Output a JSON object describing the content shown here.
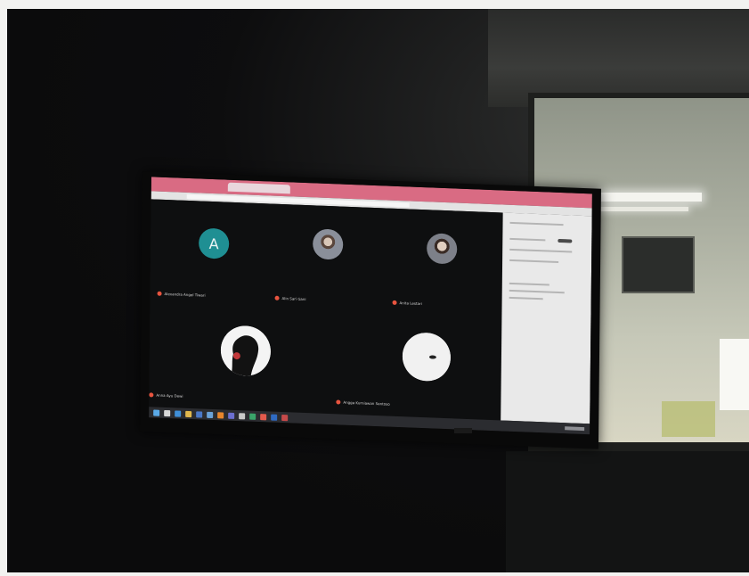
{
  "scene": {
    "description_free": true
  },
  "meeting": {
    "participants": [
      {
        "initial": "A",
        "name": "Alexandra Angel Tiwari",
        "avatar": "letter-avatar",
        "color": "#1f8f93"
      },
      {
        "name": "Alin Sari Gani",
        "avatar": "photo-avatar"
      },
      {
        "name": "Anita Lestari",
        "avatar": "photo-avatar"
      },
      {
        "name": "Anna Ayu Dewi",
        "avatar": "silhouette-avatar"
      },
      {
        "name": "Angga Kurniawan Santoso",
        "avatar": "blob-avatar"
      }
    ],
    "muted_icon": "mic-off-icon",
    "muted_color": "#e8543f"
  },
  "colors": {
    "browser_titlebar": "#d96b83",
    "meet_background": "#0e0f10",
    "side_panel": "#e9e9e9",
    "taskbar": "#2b2c30"
  },
  "taskbar": {
    "icons": [
      "start-icon",
      "search-icon",
      "edge-icon",
      "folder-icon",
      "store-icon",
      "mail-icon",
      "vlc-icon",
      "teams-icon",
      "app-icon",
      "app-icon",
      "chrome-icon",
      "word-icon",
      "app-icon"
    ],
    "icon_colors": [
      "#5aa9e6",
      "#d8d8d8",
      "#3f8fd8",
      "#e1b84d",
      "#4a78c6",
      "#6aa2d8",
      "#e8862c",
      "#6c6fd0",
      "#c9c9c9",
      "#3aa56a",
      "#e35a4c",
      "#2f6ac2",
      "#c64a4a"
    ]
  }
}
